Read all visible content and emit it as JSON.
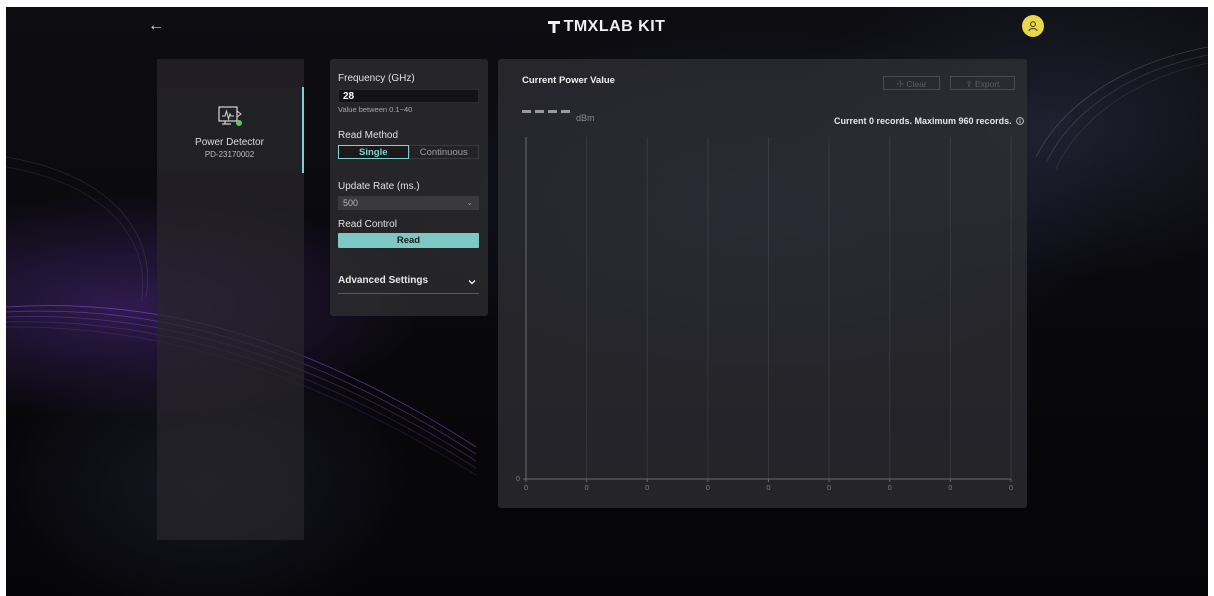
{
  "header": {
    "back_icon": "arrow-left-icon",
    "brand": "TMXLAB KIT",
    "user_icon": "user-icon",
    "avatar_color": "#e8d84a"
  },
  "devices": [
    {
      "name": "Power Detector",
      "id": "PD-23170002",
      "icon": "power-detector-icon",
      "status_color": "#5cc85c"
    }
  ],
  "settings": {
    "frequency_label": "Frequency (GHz)",
    "frequency_value": "28",
    "frequency_hint": "Value between 0.1~40",
    "read_method_label": "Read Method",
    "read_method_options": [
      "Single",
      "Continuous"
    ],
    "read_method_selected": "Single",
    "update_rate_label": "Update Rate (ms.)",
    "update_rate_value": "500",
    "read_control_label": "Read Control",
    "read_button": "Read",
    "advanced_label": "Advanced Settings",
    "accent_color": "#7ed2c9"
  },
  "chart_panel": {
    "title": "Current Power Value",
    "clear_label": "Clear",
    "export_label": "Export",
    "value_display": "----",
    "unit": "dBm",
    "records_text": "Current 0 records. Maximum 960 records."
  },
  "chart_data": {
    "type": "line",
    "title": "",
    "xlabel": "",
    "ylabel": "",
    "x_ticks": [
      "0",
      "0",
      "0",
      "0",
      "0",
      "0",
      "0",
      "0",
      "0"
    ],
    "y_ticks": [
      "0"
    ],
    "series": [],
    "grid": true,
    "legend": "none"
  }
}
